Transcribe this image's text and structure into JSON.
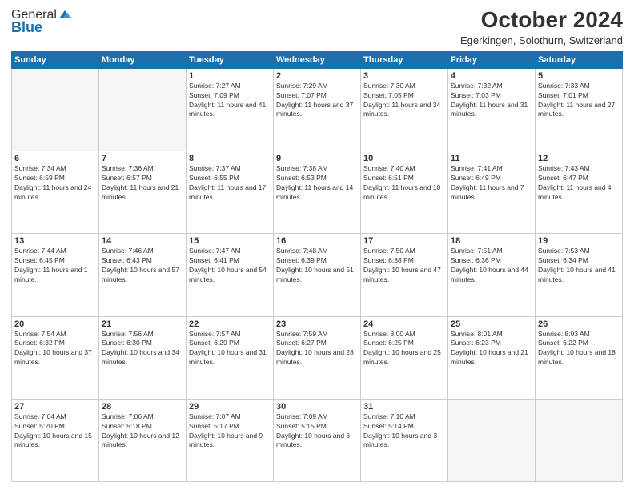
{
  "header": {
    "logo_general": "General",
    "logo_blue": "Blue",
    "month_title": "October 2024",
    "location": "Egerkingen, Solothurn, Switzerland"
  },
  "days_of_week": [
    "Sunday",
    "Monday",
    "Tuesday",
    "Wednesday",
    "Thursday",
    "Friday",
    "Saturday"
  ],
  "weeks": [
    [
      {
        "day": "",
        "info": ""
      },
      {
        "day": "",
        "info": ""
      },
      {
        "day": "1",
        "info": "Sunrise: 7:27 AM\nSunset: 7:09 PM\nDaylight: 11 hours and 41 minutes."
      },
      {
        "day": "2",
        "info": "Sunrise: 7:29 AM\nSunset: 7:07 PM\nDaylight: 11 hours and 37 minutes."
      },
      {
        "day": "3",
        "info": "Sunrise: 7:30 AM\nSunset: 7:05 PM\nDaylight: 11 hours and 34 minutes."
      },
      {
        "day": "4",
        "info": "Sunrise: 7:32 AM\nSunset: 7:03 PM\nDaylight: 11 hours and 31 minutes."
      },
      {
        "day": "5",
        "info": "Sunrise: 7:33 AM\nSunset: 7:01 PM\nDaylight: 11 hours and 27 minutes."
      }
    ],
    [
      {
        "day": "6",
        "info": "Sunrise: 7:34 AM\nSunset: 6:59 PM\nDaylight: 11 hours and 24 minutes."
      },
      {
        "day": "7",
        "info": "Sunrise: 7:36 AM\nSunset: 6:57 PM\nDaylight: 11 hours and 21 minutes."
      },
      {
        "day": "8",
        "info": "Sunrise: 7:37 AM\nSunset: 6:55 PM\nDaylight: 11 hours and 17 minutes."
      },
      {
        "day": "9",
        "info": "Sunrise: 7:38 AM\nSunset: 6:53 PM\nDaylight: 11 hours and 14 minutes."
      },
      {
        "day": "10",
        "info": "Sunrise: 7:40 AM\nSunset: 6:51 PM\nDaylight: 11 hours and 10 minutes."
      },
      {
        "day": "11",
        "info": "Sunrise: 7:41 AM\nSunset: 6:49 PM\nDaylight: 11 hours and 7 minutes."
      },
      {
        "day": "12",
        "info": "Sunrise: 7:43 AM\nSunset: 6:47 PM\nDaylight: 11 hours and 4 minutes."
      }
    ],
    [
      {
        "day": "13",
        "info": "Sunrise: 7:44 AM\nSunset: 6:45 PM\nDaylight: 11 hours and 1 minute."
      },
      {
        "day": "14",
        "info": "Sunrise: 7:46 AM\nSunset: 6:43 PM\nDaylight: 10 hours and 57 minutes."
      },
      {
        "day": "15",
        "info": "Sunrise: 7:47 AM\nSunset: 6:41 PM\nDaylight: 10 hours and 54 minutes."
      },
      {
        "day": "16",
        "info": "Sunrise: 7:48 AM\nSunset: 6:39 PM\nDaylight: 10 hours and 51 minutes."
      },
      {
        "day": "17",
        "info": "Sunrise: 7:50 AM\nSunset: 6:38 PM\nDaylight: 10 hours and 47 minutes."
      },
      {
        "day": "18",
        "info": "Sunrise: 7:51 AM\nSunset: 6:36 PM\nDaylight: 10 hours and 44 minutes."
      },
      {
        "day": "19",
        "info": "Sunrise: 7:53 AM\nSunset: 6:34 PM\nDaylight: 10 hours and 41 minutes."
      }
    ],
    [
      {
        "day": "20",
        "info": "Sunrise: 7:54 AM\nSunset: 6:32 PM\nDaylight: 10 hours and 37 minutes."
      },
      {
        "day": "21",
        "info": "Sunrise: 7:56 AM\nSunset: 6:30 PM\nDaylight: 10 hours and 34 minutes."
      },
      {
        "day": "22",
        "info": "Sunrise: 7:57 AM\nSunset: 6:29 PM\nDaylight: 10 hours and 31 minutes."
      },
      {
        "day": "23",
        "info": "Sunrise: 7:59 AM\nSunset: 6:27 PM\nDaylight: 10 hours and 28 minutes."
      },
      {
        "day": "24",
        "info": "Sunrise: 8:00 AM\nSunset: 6:25 PM\nDaylight: 10 hours and 25 minutes."
      },
      {
        "day": "25",
        "info": "Sunrise: 8:01 AM\nSunset: 6:23 PM\nDaylight: 10 hours and 21 minutes."
      },
      {
        "day": "26",
        "info": "Sunrise: 8:03 AM\nSunset: 6:22 PM\nDaylight: 10 hours and 18 minutes."
      }
    ],
    [
      {
        "day": "27",
        "info": "Sunrise: 7:04 AM\nSunset: 5:20 PM\nDaylight: 10 hours and 15 minutes."
      },
      {
        "day": "28",
        "info": "Sunrise: 7:06 AM\nSunset: 5:18 PM\nDaylight: 10 hours and 12 minutes."
      },
      {
        "day": "29",
        "info": "Sunrise: 7:07 AM\nSunset: 5:17 PM\nDaylight: 10 hours and 9 minutes."
      },
      {
        "day": "30",
        "info": "Sunrise: 7:09 AM\nSunset: 5:15 PM\nDaylight: 10 hours and 6 minutes."
      },
      {
        "day": "31",
        "info": "Sunrise: 7:10 AM\nSunset: 5:14 PM\nDaylight: 10 hours and 3 minutes."
      },
      {
        "day": "",
        "info": ""
      },
      {
        "day": "",
        "info": ""
      }
    ]
  ]
}
